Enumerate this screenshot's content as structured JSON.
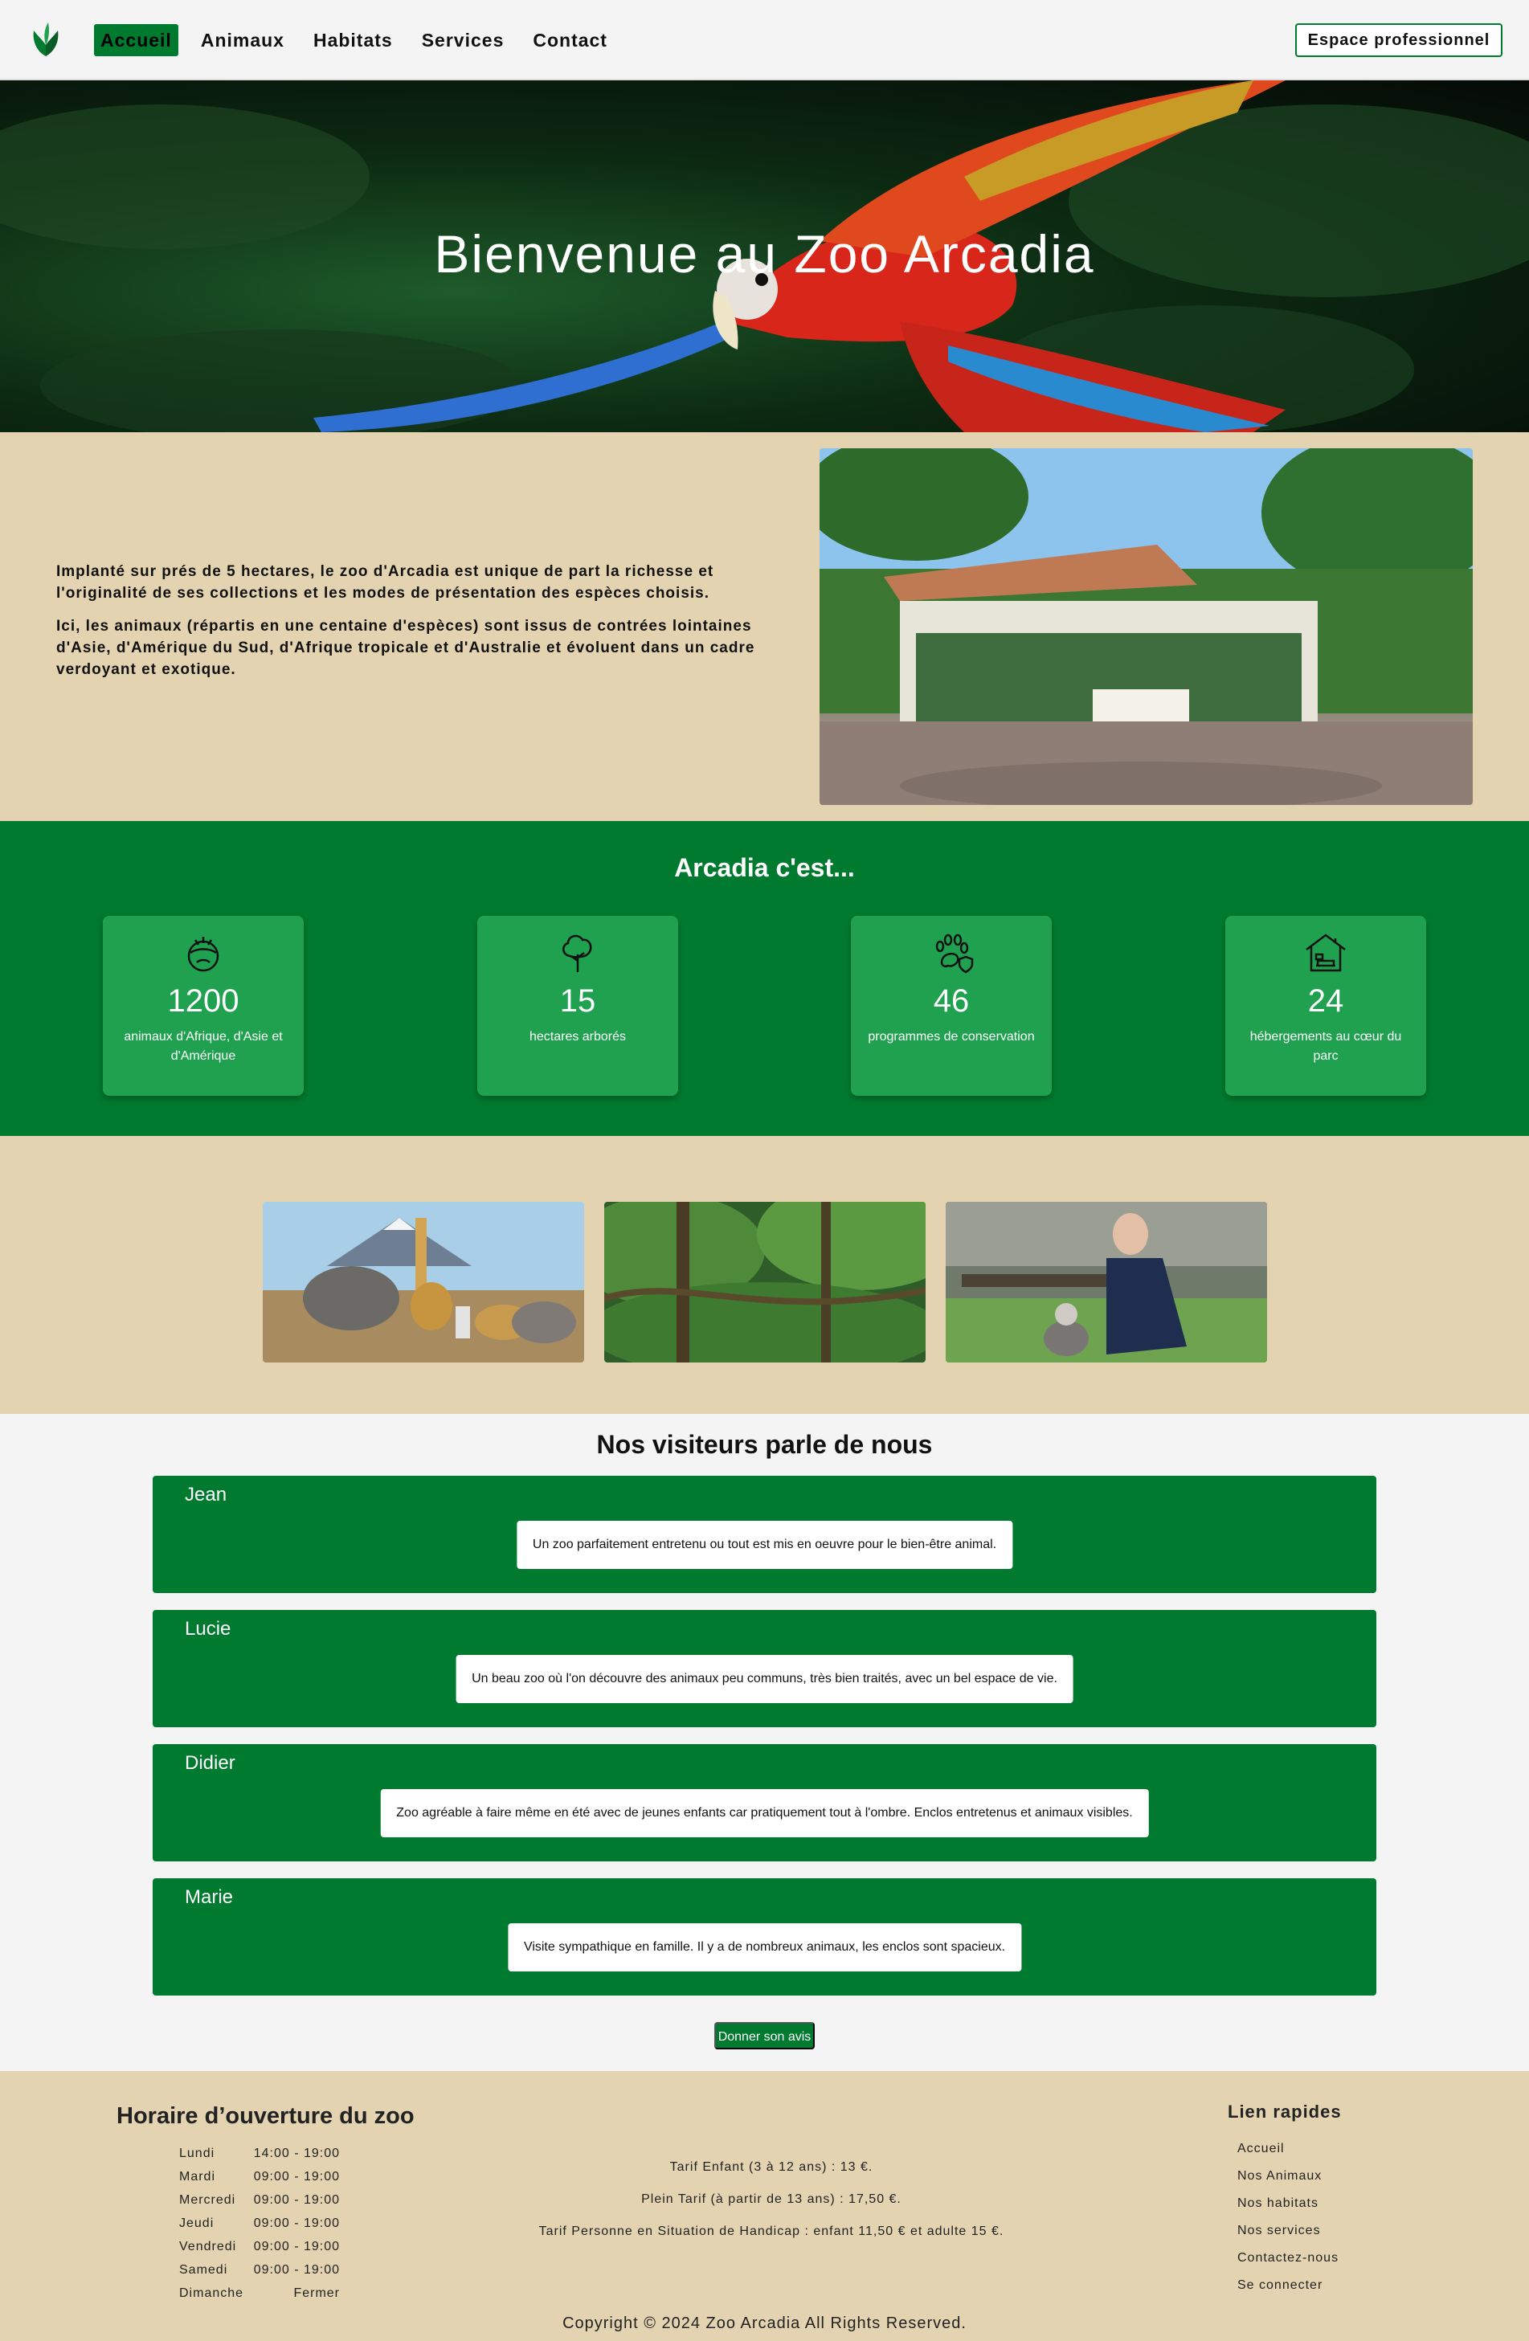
{
  "nav": {
    "logo_icon": "bird-leaf-logo-icon",
    "links": [
      {
        "label": "Accueil",
        "active": true
      },
      {
        "label": "Animaux",
        "active": false
      },
      {
        "label": "Habitats",
        "active": false
      },
      {
        "label": "Services",
        "active": false
      },
      {
        "label": "Contact",
        "active": false
      }
    ],
    "pro_button": "Espace professionnel"
  },
  "hero": {
    "title": "Bienvenue au Zoo Arcadia"
  },
  "intro": {
    "paragraph1": "Implanté sur prés de 5 hectares, le zoo d'Arcadia est unique de part la richesse et l'originalité de ses collections et les modes de présentation des espèces choisis.",
    "paragraph2": "Ici, les animaux (répartis en une centaine d'espèces) sont issus de contrées lointaines d'Asie, d'Amérique du Sud, d'Afrique tropicale et d'Australie et évoluent dans un cadre verdoyant et exotique."
  },
  "stats": {
    "title": "Arcadia c'est...",
    "items": [
      {
        "icon": "globe-animals-icon",
        "number": "1200",
        "label": "animaux d'Afrique, d'Asie et d'Amérique"
      },
      {
        "icon": "tree-icon",
        "number": "15",
        "label": "hectares arborés"
      },
      {
        "icon": "paw-shield-icon",
        "number": "46",
        "label": "programmes de conservation"
      },
      {
        "icon": "lodge-icon",
        "number": "24",
        "label": "hébergements au cœur du parc"
      }
    ]
  },
  "reviews": {
    "title": "Nos visiteurs parle de nous",
    "items": [
      {
        "name": "Jean",
        "text": "Un zoo parfaitement entretenu ou tout est mis en oeuvre pour le bien-être animal."
      },
      {
        "name": "Lucie",
        "text": "Un beau zoo où l'on découvre des animaux peu communs, très bien traités, avec un bel espace de vie."
      },
      {
        "name": "Didier",
        "text": "Zoo agréable à faire même en été avec de jeunes enfants car pratiquement tout à l'ombre. Enclos entretenus et animaux visibles."
      },
      {
        "name": "Marie",
        "text": "Visite sympathique en famille. Il y a de nombreux animaux, les enclos sont spacieux."
      }
    ],
    "button": "Donner son avis"
  },
  "footer": {
    "hours_title": "Horaire d’ouverture du zoo",
    "hours": [
      {
        "day": "Lundi",
        "time": "14:00 - 19:00"
      },
      {
        "day": "Mardi",
        "time": "09:00 - 19:00"
      },
      {
        "day": "Mercredi",
        "time": "09:00 - 19:00"
      },
      {
        "day": "Jeudi",
        "time": "09:00 - 19:00"
      },
      {
        "day": "Vendredi",
        "time": "09:00 - 19:00"
      },
      {
        "day": "Samedi",
        "time": "09:00 - 19:00"
      },
      {
        "day": "Dimanche",
        "time": "Fermer"
      }
    ],
    "prices": [
      "Tarif Enfant (3 à 12 ans) : 13 €.",
      "Plein Tarif (à partir de 13 ans) : 17,50 €.",
      "Tarif Personne en Situation de Handicap : enfant 11,50 € et adulte 15 €."
    ],
    "links_title": "Lien rapides",
    "links": [
      "Accueil",
      "Nos Animaux",
      "Nos habitats",
      "Nos services",
      "Contactez-nous",
      "Se connecter"
    ],
    "copyright": "Copyright © 2024 Zoo Arcadia All Rights Reserved."
  },
  "colors": {
    "brand_green": "#007a2e",
    "card_green": "#1fa150",
    "sand": "#e3d3b1"
  }
}
